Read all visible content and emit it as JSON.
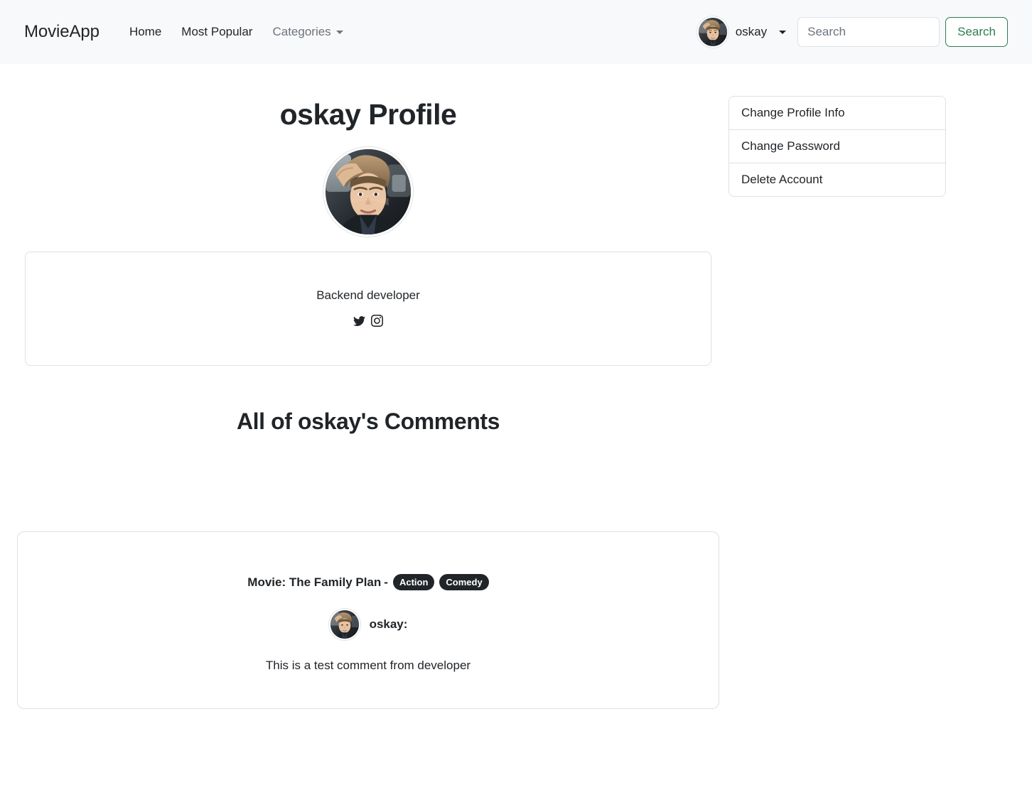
{
  "navbar": {
    "brand": "MovieApp",
    "links": [
      {
        "label": "Home",
        "muted": false
      },
      {
        "label": "Most Popular",
        "muted": false
      },
      {
        "label": "Categories",
        "muted": true
      }
    ],
    "user": {
      "name": "oskay",
      "avatar_alt": "oskay avatar"
    },
    "search": {
      "placeholder": "Search",
      "value": "",
      "button_label": "Search",
      "button_color": "#2e7d4f"
    },
    "background_color": "#f8f9fa"
  },
  "sidebar": {
    "items": [
      {
        "label": "Change Profile Info"
      },
      {
        "label": "Change Password"
      },
      {
        "label": "Delete Account"
      }
    ]
  },
  "profile": {
    "title": "oskay Profile",
    "avatar_alt": "oskay profile photo",
    "bio": "Backend developer",
    "socials": [
      {
        "name": "twitter",
        "icon": "twitter-icon"
      },
      {
        "name": "instagram",
        "icon": "instagram-icon"
      }
    ]
  },
  "comments": {
    "heading": "All of oskay's Comments",
    "items": [
      {
        "movie_prefix": "Movie: The Family Plan",
        "separator": "-",
        "genres": [
          "Action",
          "Comedy"
        ],
        "author": "oskay:",
        "text": "This is a test comment from developer"
      }
    ]
  }
}
